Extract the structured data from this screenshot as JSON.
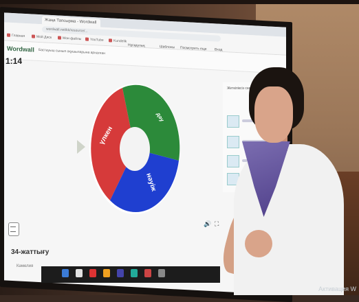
{
  "browser": {
    "tab_title": "Жаңа Тапсырма - Wordwall",
    "url": "wordwall.net/kk/resource/...",
    "bookmarks": [
      "Главная",
      "Мой Диск",
      "Мои файлы",
      "YouTube",
      "Kundelik"
    ]
  },
  "app": {
    "logo": "Wordwall",
    "subtitle": "Бастауыш сынып оқушыларына арналған",
    "menu": [
      "Нұсқаулық",
      "Шаблоны",
      "Посмотреть еще",
      "Вход"
    ]
  },
  "timer": "1:14",
  "wheel": {
    "segments": [
      {
        "label": "үлкен",
        "color": "#d63a3a"
      },
      {
        "label": "дәу",
        "color": "#2c8a3a"
      },
      {
        "label": "нәуіж",
        "color": "#1f3fd0"
      }
    ]
  },
  "panel": {
    "title": "Жеткіліксіз сөздер"
  },
  "footer": {
    "title": "34-жаттығу",
    "subtitle": "Кәмелия"
  },
  "watermark": "Активация W"
}
